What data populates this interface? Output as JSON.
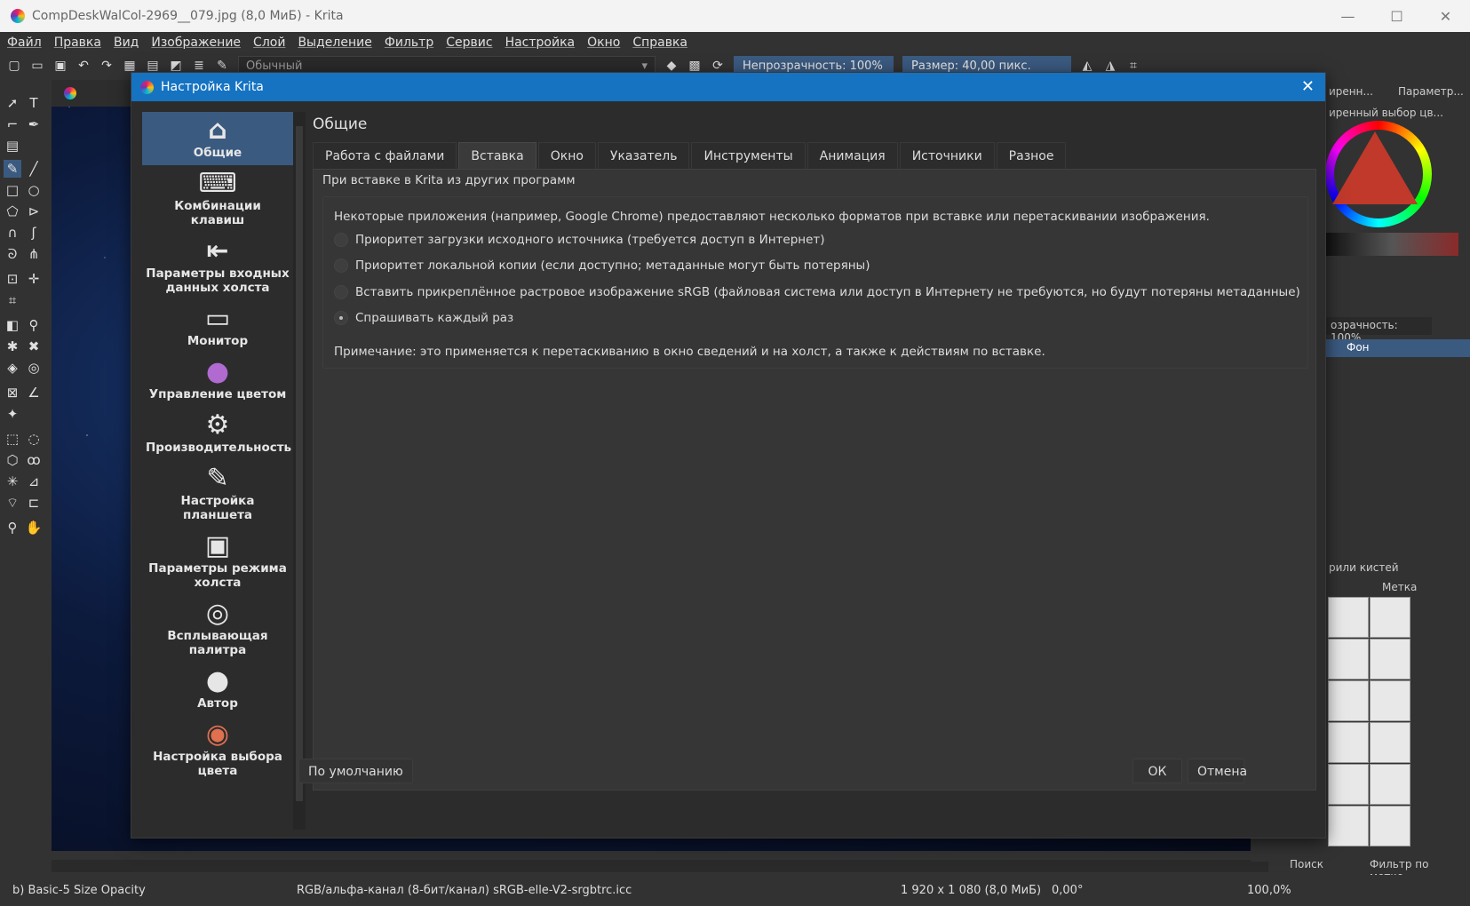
{
  "window": {
    "title": "CompDeskWalCol-2969__079.jpg (8,0 МиБ) - Krita"
  },
  "menu": [
    "Файл",
    "Правка",
    "Вид",
    "Изображение",
    "Слой",
    "Выделение",
    "Фильтр",
    "Сервис",
    "Настройка",
    "Окно",
    "Справка"
  ],
  "toolbar": {
    "blend_mode": "Обычный",
    "opacity": "Непрозрачность: 100%",
    "size": "Размер: 40,00 пикс."
  },
  "dock": {
    "tab1": "иренн...",
    "tab2": "Параметр...",
    "color_title": "иренный выбор цв...",
    "layer_opacity": "озрачность: 100%",
    "layer_name": "Фон",
    "brush_presets": "рили кистей",
    "tag": "Метка",
    "search": "Поиск",
    "filter": "Фильтр по метке"
  },
  "status": {
    "brush": "b) Basic-5 Size Opacity",
    "colorspace": "RGB/альфа-канал (8-бит/канал)  sRGB-elle-V2-srgbtrc.icc",
    "dims": "1 920 x 1 080 (8,0 МиБ)",
    "angle": "0,00°",
    "zoom": "100,0%"
  },
  "dialog": {
    "title": "Настройка Krita",
    "page_title": "Общие",
    "sidebar": [
      {
        "label": "Общие",
        "icon": "home-icon",
        "glyph": "⌂"
      },
      {
        "label": "Комбинации клавиш",
        "icon": "keyboard-icon",
        "glyph": "⌨"
      },
      {
        "label": "Параметры входных данных холста",
        "icon": "input-icon",
        "glyph": "⇤"
      },
      {
        "label": "Монитор",
        "icon": "monitor-icon",
        "glyph": "▭"
      },
      {
        "label": "Управление цветом",
        "icon": "color-management-icon",
        "glyph": "●"
      },
      {
        "label": "Производительность",
        "icon": "gears-icon",
        "glyph": "⚙"
      },
      {
        "label": "Настройка планшета",
        "icon": "tablet-icon",
        "glyph": "✎"
      },
      {
        "label": "Параметры режима холста",
        "icon": "canvas-image-icon",
        "glyph": "▣"
      },
      {
        "label": "Всплывающая палитра",
        "icon": "popup-palette-icon",
        "glyph": "◎"
      },
      {
        "label": "Автор",
        "icon": "author-icon",
        "glyph": "●"
      },
      {
        "label": "Настройка выбора цвета",
        "icon": "color-selector-icon",
        "glyph": "◉"
      }
    ],
    "tabs": [
      "Работа с файлами",
      "Вставка",
      "Окно",
      "Указатель",
      "Инструменты",
      "Анимация",
      "Источники",
      "Разное"
    ],
    "group_title": "При вставке в Krita из других программ",
    "description": "Некоторые приложения (например, Google Chrome) предоставляют несколько форматов при вставке или перетаскивании изображения.",
    "options": [
      "Приоритет загрузки исходного источника (требуется доступ в Интернет)",
      "Приоритет локальной копии (если доступно; метаданные могут быть потеряны)",
      "Вставить прикреплённое растровое изображение sRGB (файловая система или доступ в Интернету не требуются, но будут потеряны метаданные)",
      "Спрашивать каждый раз"
    ],
    "selected_option": 3,
    "note": "Примечание: это применяется к перетаскиванию в окно сведений и на холст, а также к действиям по вставке.",
    "btn_default": "По умолчанию",
    "btn_ok": "ОК",
    "btn_cancel": "Отмена"
  },
  "colors": {
    "accent": "#1573c2",
    "selection": "#3b5a80"
  }
}
